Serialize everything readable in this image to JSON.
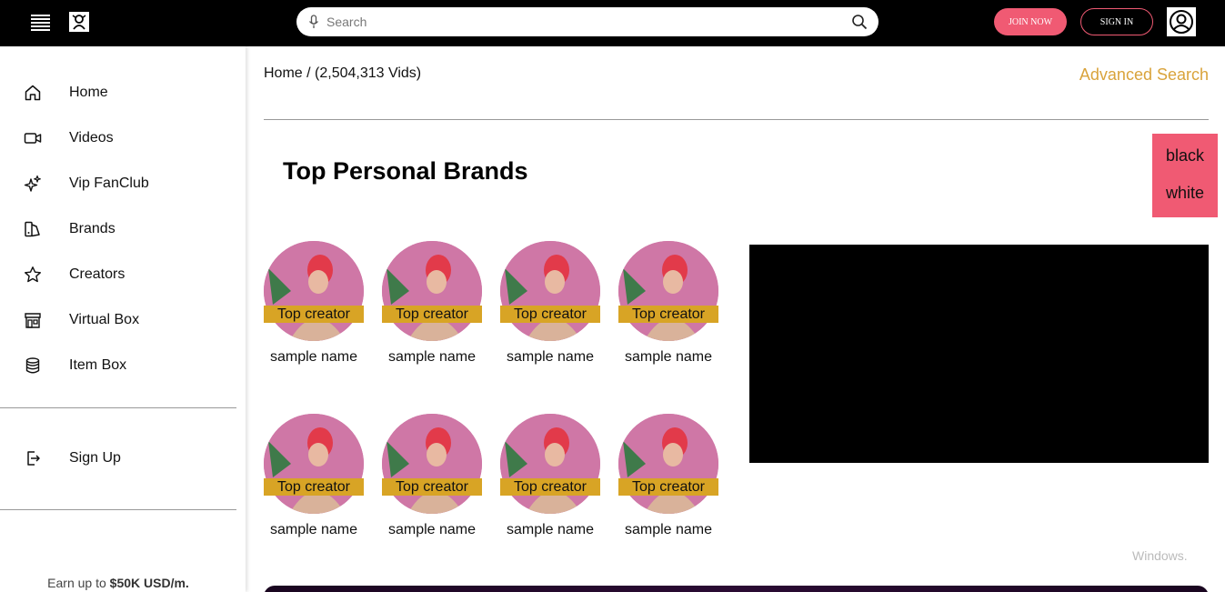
{
  "header": {
    "search_placeholder": "Search",
    "join_label": "JOIN NOW",
    "signin_label": "SIGN IN",
    "accent_color": "#f05a73"
  },
  "sidebar": {
    "items": [
      {
        "label": "Home",
        "icon": "home-icon"
      },
      {
        "label": "Videos",
        "icon": "video-camera-icon"
      },
      {
        "label": "Vip FanClub",
        "icon": "sparkles-icon"
      },
      {
        "label": "Brands",
        "icon": "brands-icon"
      },
      {
        "label": "Creators",
        "icon": "star-icon"
      },
      {
        "label": "Virtual Box",
        "icon": "storefront-icon"
      },
      {
        "label": "Item Box",
        "icon": "database-icon"
      }
    ],
    "signup": {
      "label": "Sign Up",
      "icon": "sign-in-arrow-icon"
    },
    "earn_prefix": "Earn up to ",
    "earn_amount": "$50K USD/m."
  },
  "main": {
    "breadcrumb": "Home / (2,504,313 Vids)",
    "advanced_search": "Advanced Search",
    "section_title": "Top Personal Brands",
    "theme_toggle": {
      "black": "black",
      "white": "white"
    },
    "creators": [
      {
        "badge": "Top creator",
        "name": "sample name"
      },
      {
        "badge": "Top creator",
        "name": "sample name"
      },
      {
        "badge": "Top creator",
        "name": "sample name"
      },
      {
        "badge": "Top creator",
        "name": "sample name"
      },
      {
        "badge": "Top creator",
        "name": "sample name"
      },
      {
        "badge": "Top creator",
        "name": "sample name"
      },
      {
        "badge": "Top creator",
        "name": "sample name"
      },
      {
        "badge": "Top creator",
        "name": "sample name"
      }
    ],
    "watermark": "Windows."
  }
}
